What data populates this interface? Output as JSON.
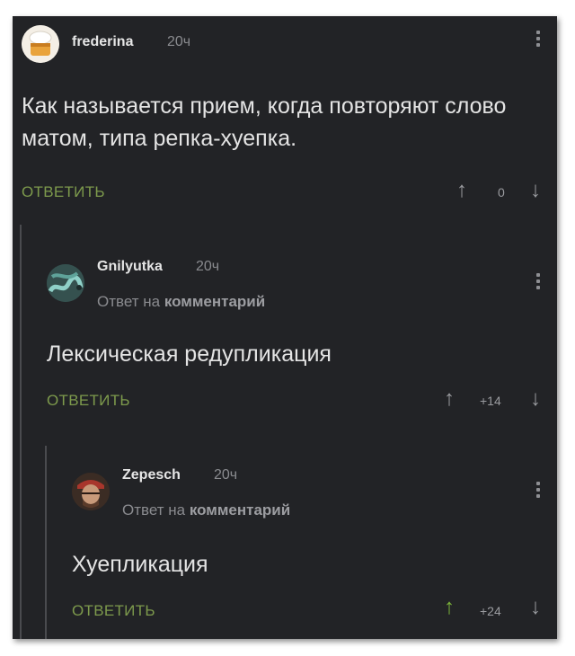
{
  "comments": [
    {
      "username": "frederina",
      "time": "20ч",
      "text": "Как называется прием, когда повторяют слово матом, типа репка-хуепка.",
      "reply_label": "ОТВЕТИТЬ",
      "score": "0",
      "up_icon": "arrow-up-icon",
      "down_icon": "arrow-down-icon"
    },
    {
      "username": "Gnilyutka",
      "time": "20ч",
      "reply_to_prefix": "Ответ на",
      "reply_to_target": "комментарий",
      "text": "Лексическая редупликация",
      "reply_label": "ОТВЕТИТЬ",
      "score": "+14"
    },
    {
      "username": "Zepesch",
      "time": "20ч",
      "reply_to_prefix": "Ответ на",
      "reply_to_target": "комментарий",
      "text": "Хуепликация",
      "reply_label": "ОТВЕТИТЬ",
      "score": "+24",
      "upvote_color": "#7bb33a"
    }
  ],
  "colors": {
    "background": "#222326",
    "reply_green": "#7d9a4c",
    "upvote_active": "#7bb33a",
    "text": "#e4e4e4",
    "muted": "#8a8b8f"
  }
}
